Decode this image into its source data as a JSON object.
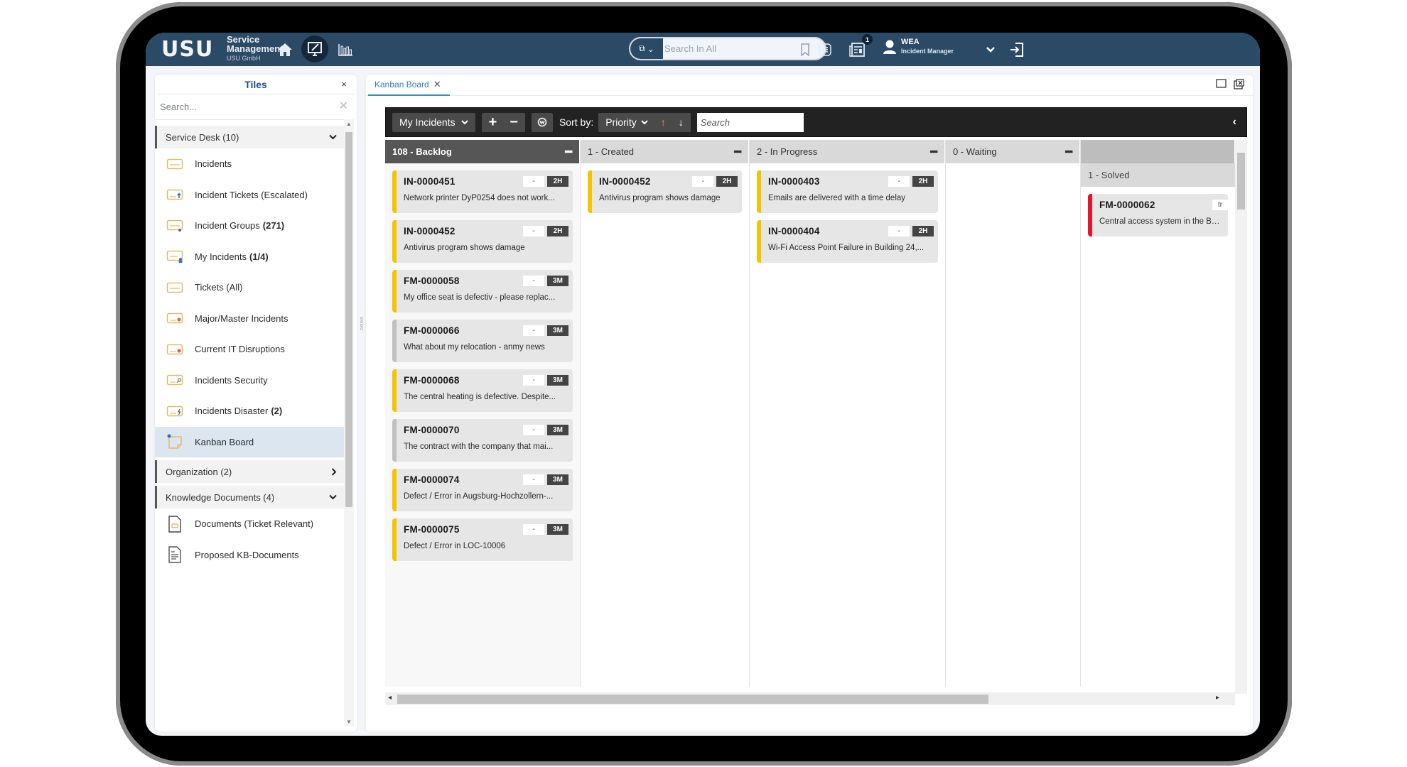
{
  "header": {
    "logo": "USU",
    "brand_line1": "Service",
    "brand_line2": "Management",
    "brand_line3": "USU GmbH",
    "nav_icons": [
      "home-icon",
      "workspace-icon",
      "reports-icon"
    ],
    "search_placeholder": "Search In All",
    "notifications_count": "1",
    "user_name": "WEA",
    "user_role": "Incident Manager"
  },
  "sidebar": {
    "title": "Tiles",
    "search_placeholder": "Search...",
    "groups": [
      {
        "label": "Service Desk (10)",
        "expanded": true,
        "items": [
          {
            "label": "Incidents",
            "count": ""
          },
          {
            "label": "Incident Tickets (Escalated)",
            "count": ""
          },
          {
            "label": "Incident Groups",
            "count": "(271)"
          },
          {
            "label": "My Incidents",
            "count": "(1/4)"
          },
          {
            "label": "Tickets (All)",
            "count": ""
          },
          {
            "label": "Major/Master Incidents",
            "count": ""
          },
          {
            "label": "Current IT Disruptions",
            "count": ""
          },
          {
            "label": "Incidents Security",
            "count": ""
          },
          {
            "label": "Incidents Disaster",
            "count": "(2)"
          },
          {
            "label": "Kanban Board",
            "count": "",
            "selected": true
          }
        ]
      },
      {
        "label": "Organization (2)",
        "expanded": false,
        "items": []
      },
      {
        "label": "Knowledge Documents (4)",
        "expanded": true,
        "items": [
          {
            "label": "Documents (Ticket Relevant)",
            "count": ""
          },
          {
            "label": "Proposed KB-Documents",
            "count": ""
          }
        ]
      }
    ]
  },
  "main": {
    "tab_label": "Kanban Board",
    "toolbar": {
      "filter_label": "My Incidents",
      "sort_label": "Sort by:",
      "sort_value": "Priority",
      "search_placeholder": "Search"
    },
    "columns": [
      {
        "title": "108 - Backlog",
        "cards": [
          {
            "id": "IN-0000451",
            "status": "-",
            "priority": "2H",
            "desc": "Network printer DyP0254 does not work...",
            "color": "yellow"
          },
          {
            "id": "IN-0000452",
            "status": "-",
            "priority": "2H",
            "desc": "Antivirus program shows damage",
            "color": "yellow"
          },
          {
            "id": "FM-0000058",
            "status": "-",
            "priority": "3M",
            "desc": "My office seat is defectiv - please replac...",
            "color": "yellow"
          },
          {
            "id": "FM-0000066",
            "status": "-",
            "priority": "3M",
            "desc": "What about my relocation - anmy news",
            "color": "grey"
          },
          {
            "id": "FM-0000068",
            "status": "-",
            "priority": "3M",
            "desc": "The central heating is defective. Despite...",
            "color": "yellow"
          },
          {
            "id": "FM-0000070",
            "status": "-",
            "priority": "3M",
            "desc": "The contract with the company that mai...",
            "color": "grey"
          },
          {
            "id": "FM-0000074",
            "status": "-",
            "priority": "3M",
            "desc": "Defect / Error in Augsburg-Hochzollern-...",
            "color": "yellow"
          },
          {
            "id": "FM-0000075",
            "status": "-",
            "priority": "3M",
            "desc": "Defect / Error in LOC-10006",
            "color": "yellow"
          }
        ]
      },
      {
        "title": "1 - Created",
        "cards": [
          {
            "id": "IN-0000452",
            "status": "-",
            "priority": "2H",
            "desc": "Antivirus program shows damage",
            "color": "yellow"
          }
        ]
      },
      {
        "title": "2 - In Progress",
        "cards": [
          {
            "id": "IN-0000403",
            "status": "-",
            "priority": "2H",
            "desc": "Emails are delivered with a time delay",
            "color": "yellow"
          },
          {
            "id": "IN-0000404",
            "status": "-",
            "priority": "2H",
            "desc": "Wi-Fi Access Point Failure in Building 24,...",
            "color": "yellow"
          }
        ]
      },
      {
        "title": "0 - Waiting",
        "cards": []
      },
      {
        "title": "",
        "subtitle": "1 - Solved",
        "cards": [
          {
            "id": "FM-0000062",
            "status": "tr",
            "priority": "",
            "desc": "Central access system in the Bahnhof",
            "color": "red"
          }
        ]
      }
    ]
  },
  "colors": {
    "header_bg": "#2a4a66",
    "accent_link": "#2f7fb7",
    "card_yellow": "#f5c400",
    "card_red": "#e8132c",
    "card_grey": "#c0c0c0",
    "toolbar_bg": "#222222"
  }
}
